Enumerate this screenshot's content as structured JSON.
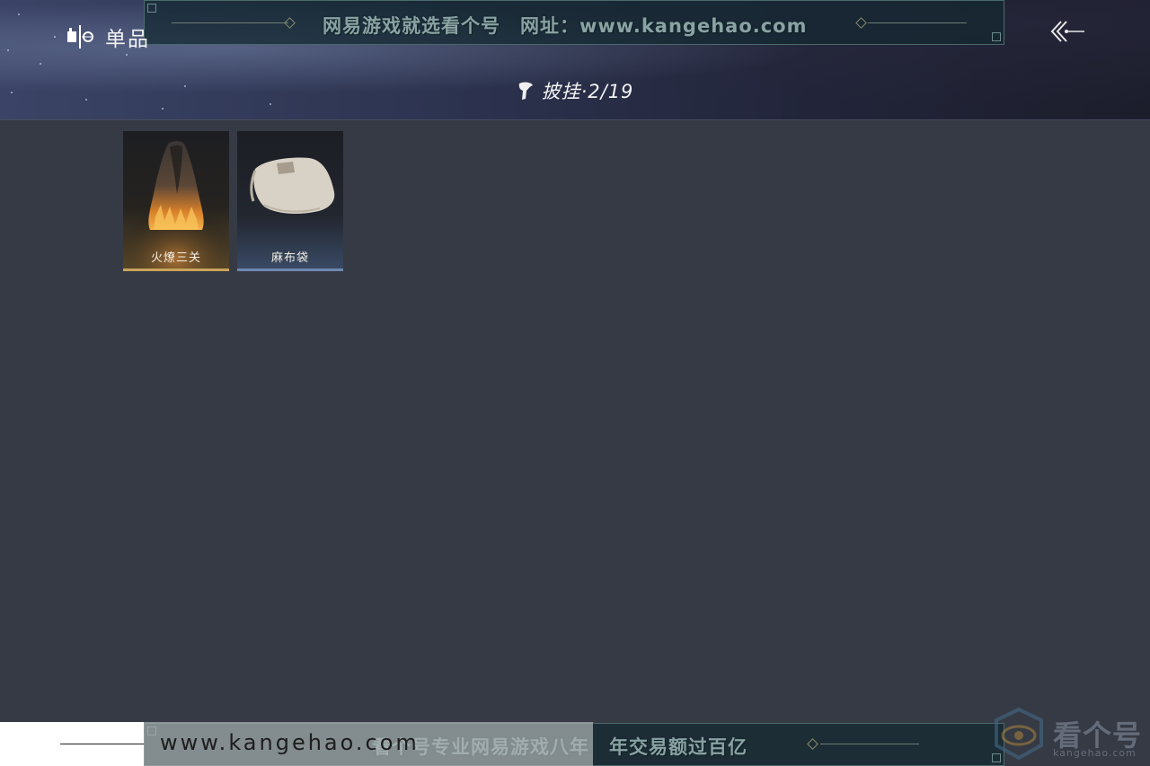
{
  "header": {
    "section_title": "单品",
    "category_title": "披挂·2/19"
  },
  "watermark_top": {
    "text": "网易游戏就选看个号　网址：www.kangehao.com"
  },
  "items": [
    {
      "name": "火燎三关",
      "style": "fire"
    },
    {
      "name": "麻布袋",
      "style": "blue"
    }
  ],
  "watermark_bottom": {
    "text": "看个号专业网易游戏八年　年交易额过百亿",
    "site": "www.kangehao.com"
  },
  "logo": {
    "text": "看个号",
    "sub": "kangehao.com"
  }
}
